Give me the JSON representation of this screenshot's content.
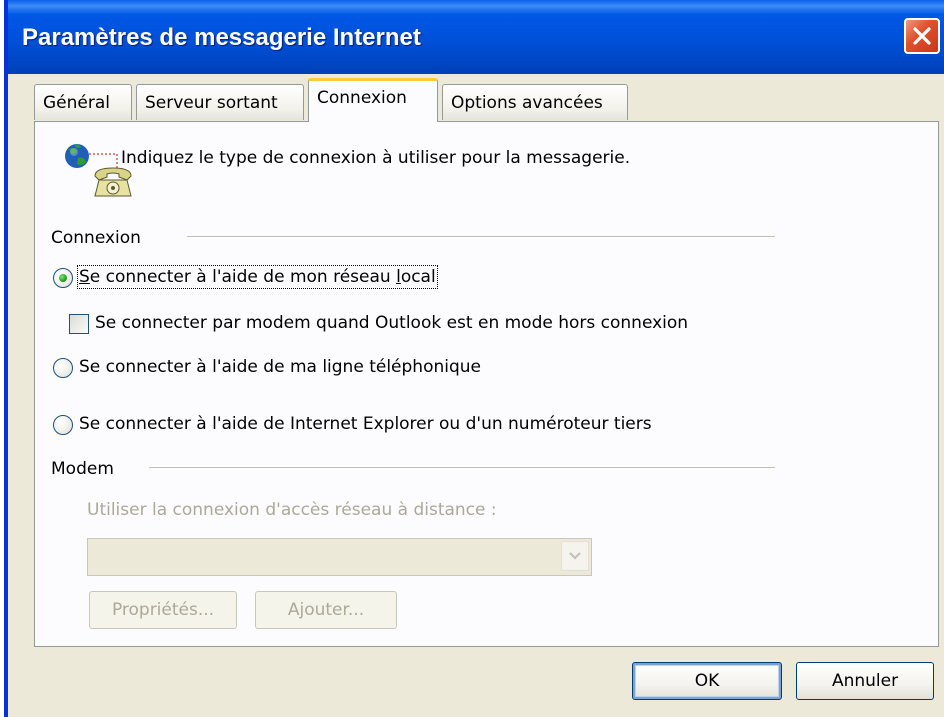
{
  "window": {
    "title": "Paramètres de messagerie Internet",
    "colors": {
      "titlebar": "#0054e3",
      "close_button": "#e0522f",
      "face": "#ece9d8",
      "active_tab_accent": "#ffc73c",
      "radio_selected": "#21a121"
    }
  },
  "tabs": [
    {
      "label": "Général",
      "active": false
    },
    {
      "label": "Serveur sortant",
      "active": false
    },
    {
      "label": "Connexion",
      "active": true
    },
    {
      "label": "Options avancées",
      "active": false
    }
  ],
  "intro": {
    "icon": "globe-phone-icon",
    "text": "Indiquez le type de connexion à utiliser pour la messagerie."
  },
  "connection_group": {
    "label": "Connexion",
    "options": [
      {
        "label": "Se connecter à l'aide de mon réseau local",
        "selected": true
      },
      {
        "label": "Se connecter à l'aide de ma ligne téléphonique",
        "selected": false
      },
      {
        "label": "Se connecter à l'aide de Internet Explorer ou d'un numéroteur tiers",
        "selected": false
      }
    ],
    "modem_offline_checkbox": {
      "label": "Se connecter par modem quand Outlook est en mode hors connexion",
      "checked": false
    }
  },
  "modem_group": {
    "label": "Modem",
    "dialup_label": "Utiliser la connexion d'accès réseau à distance :",
    "dialup_value": "",
    "properties_button": "Propriétés...",
    "add_button": "Ajouter..."
  },
  "footer": {
    "ok_label": "OK",
    "cancel_label": "Annuler"
  }
}
